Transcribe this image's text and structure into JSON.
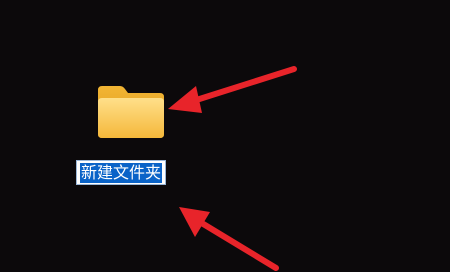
{
  "desktop": {
    "background_color": "#0c090b",
    "folder": {
      "icon": "folder-icon",
      "name_value": "新建文件夹",
      "selection_color": "#0a63c8"
    },
    "annotations": {
      "arrow_color": "#e8242a",
      "arrows": [
        "arrow-to-folder-icon",
        "arrow-to-name-field"
      ]
    }
  }
}
